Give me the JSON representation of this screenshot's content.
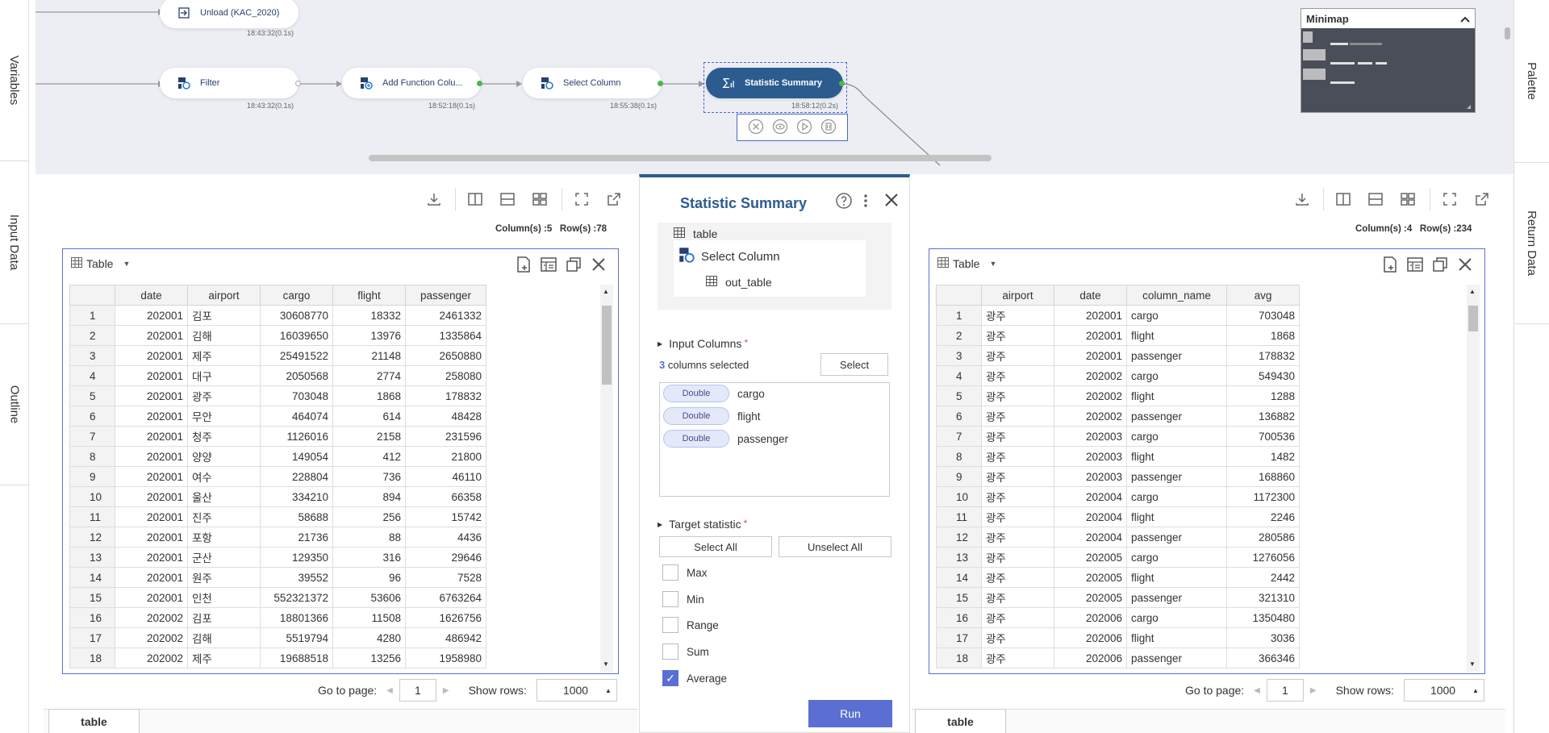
{
  "left_tabs": [
    "Variables",
    "Input Data",
    "Outline"
  ],
  "right_tabs": [
    "Palette",
    "Return Data"
  ],
  "nodes": {
    "unload": {
      "label": "Unload (KAC_2020)",
      "time": "18:43:32(0.1s)",
      "icon": "unload-icon"
    },
    "filter": {
      "label": "Filter",
      "time": "18:43:32(0.1s)",
      "icon": "filter-icon"
    },
    "add_function": {
      "label": "Add Function Colu...",
      "time": "18:52:18(0.1s)",
      "icon": "add-function-icon"
    },
    "select_column": {
      "label": "Select Column",
      "time": "18:55:38(0.1s)",
      "icon": "select-column-icon"
    },
    "statistic_summary": {
      "label": "Statistic Summary",
      "time": "18:58:12(0.2s)",
      "icon": "sigma-chart-icon"
    }
  },
  "minimap": {
    "title": "Minimap"
  },
  "left_panel": {
    "column_count": "Column(s) :5",
    "row_count": "Row(s) :78",
    "table_label": "Table",
    "headers": [
      "date",
      "airport",
      "cargo",
      "flight",
      "passenger"
    ],
    "rows": [
      [
        "1",
        "202001",
        "김포",
        "30608770",
        "18332",
        "2461332"
      ],
      [
        "2",
        "202001",
        "김해",
        "16039650",
        "13976",
        "1335864"
      ],
      [
        "3",
        "202001",
        "제주",
        "25491522",
        "21148",
        "2650880"
      ],
      [
        "4",
        "202001",
        "대구",
        "2050568",
        "2774",
        "258080"
      ],
      [
        "5",
        "202001",
        "광주",
        "703048",
        "1868",
        "178832"
      ],
      [
        "6",
        "202001",
        "무안",
        "464074",
        "614",
        "48428"
      ],
      [
        "7",
        "202001",
        "청주",
        "1126016",
        "2158",
        "231596"
      ],
      [
        "8",
        "202001",
        "양양",
        "149054",
        "412",
        "21800"
      ],
      [
        "9",
        "202001",
        "여수",
        "228804",
        "736",
        "46110"
      ],
      [
        "10",
        "202001",
        "울산",
        "334210",
        "894",
        "66358"
      ],
      [
        "11",
        "202001",
        "진주",
        "58688",
        "256",
        "15742"
      ],
      [
        "12",
        "202001",
        "포항",
        "21736",
        "88",
        "4436"
      ],
      [
        "13",
        "202001",
        "군산",
        "129350",
        "316",
        "29646"
      ],
      [
        "14",
        "202001",
        "원주",
        "39552",
        "96",
        "7528"
      ],
      [
        "15",
        "202001",
        "인천",
        "552321372",
        "53606",
        "6763264"
      ],
      [
        "16",
        "202002",
        "김포",
        "18801366",
        "11508",
        "1626756"
      ],
      [
        "17",
        "202002",
        "김해",
        "5519794",
        "4280",
        "486942"
      ],
      [
        "18",
        "202002",
        "제주",
        "19688518",
        "13256",
        "1958980"
      ]
    ],
    "go_to_page_label": "Go to page:",
    "page_value": "1",
    "show_rows_label": "Show rows:",
    "show_rows_value": "1000",
    "bottom_tab": "table"
  },
  "right_panel": {
    "column_count": "Column(s) :4",
    "row_count": "Row(s) :234",
    "table_label": "Table",
    "headers": [
      "airport",
      "date",
      "column_name",
      "avg"
    ],
    "rows": [
      [
        "1",
        "광주",
        "202001",
        "cargo",
        "703048"
      ],
      [
        "2",
        "광주",
        "202001",
        "flight",
        "1868"
      ],
      [
        "3",
        "광주",
        "202001",
        "passenger",
        "178832"
      ],
      [
        "4",
        "광주",
        "202002",
        "cargo",
        "549430"
      ],
      [
        "5",
        "광주",
        "202002",
        "flight",
        "1288"
      ],
      [
        "6",
        "광주",
        "202002",
        "passenger",
        "136882"
      ],
      [
        "7",
        "광주",
        "202003",
        "cargo",
        "700536"
      ],
      [
        "8",
        "광주",
        "202003",
        "flight",
        "1482"
      ],
      [
        "9",
        "광주",
        "202003",
        "passenger",
        "168860"
      ],
      [
        "10",
        "광주",
        "202004",
        "cargo",
        "1172300"
      ],
      [
        "11",
        "광주",
        "202004",
        "flight",
        "2246"
      ],
      [
        "12",
        "광주",
        "202004",
        "passenger",
        "280586"
      ],
      [
        "13",
        "광주",
        "202005",
        "cargo",
        "1276056"
      ],
      [
        "14",
        "광주",
        "202005",
        "flight",
        "2442"
      ],
      [
        "15",
        "광주",
        "202005",
        "passenger",
        "321310"
      ],
      [
        "16",
        "광주",
        "202006",
        "cargo",
        "1350480"
      ],
      [
        "17",
        "광주",
        "202006",
        "flight",
        "3036"
      ],
      [
        "18",
        "광주",
        "202006",
        "passenger",
        "366346"
      ]
    ],
    "go_to_page_label": "Go to page:",
    "page_value": "1",
    "show_rows_label": "Show rows:",
    "show_rows_value": "1000",
    "bottom_tab": "table"
  },
  "dialog": {
    "title": "Statistic Summary",
    "tree": {
      "root": "table",
      "node": "Select Column",
      "child": "out_table"
    },
    "input_columns": {
      "label": "Input Columns",
      "required": "*",
      "count": "3",
      "count_suffix": " columns selected",
      "select_button": "Select",
      "items": [
        {
          "type": "Double",
          "name": "cargo"
        },
        {
          "type": "Double",
          "name": "flight"
        },
        {
          "type": "Double",
          "name": "passenger"
        }
      ]
    },
    "target_statistic": {
      "label": "Target statistic",
      "required": "*",
      "select_all": "Select All",
      "unselect_all": "Unselect All",
      "options": [
        {
          "label": "Max",
          "checked": false
        },
        {
          "label": "Min",
          "checked": false
        },
        {
          "label": "Range",
          "checked": false
        },
        {
          "label": "Sum",
          "checked": false
        },
        {
          "label": "Average",
          "checked": true
        }
      ]
    },
    "run_button": "Run"
  },
  "colors": {
    "accent": "#5a6fd1",
    "node_selected": "#2c5c8f",
    "dialog_title": "#2c5c8f",
    "table_border": "#5b6fd6"
  }
}
